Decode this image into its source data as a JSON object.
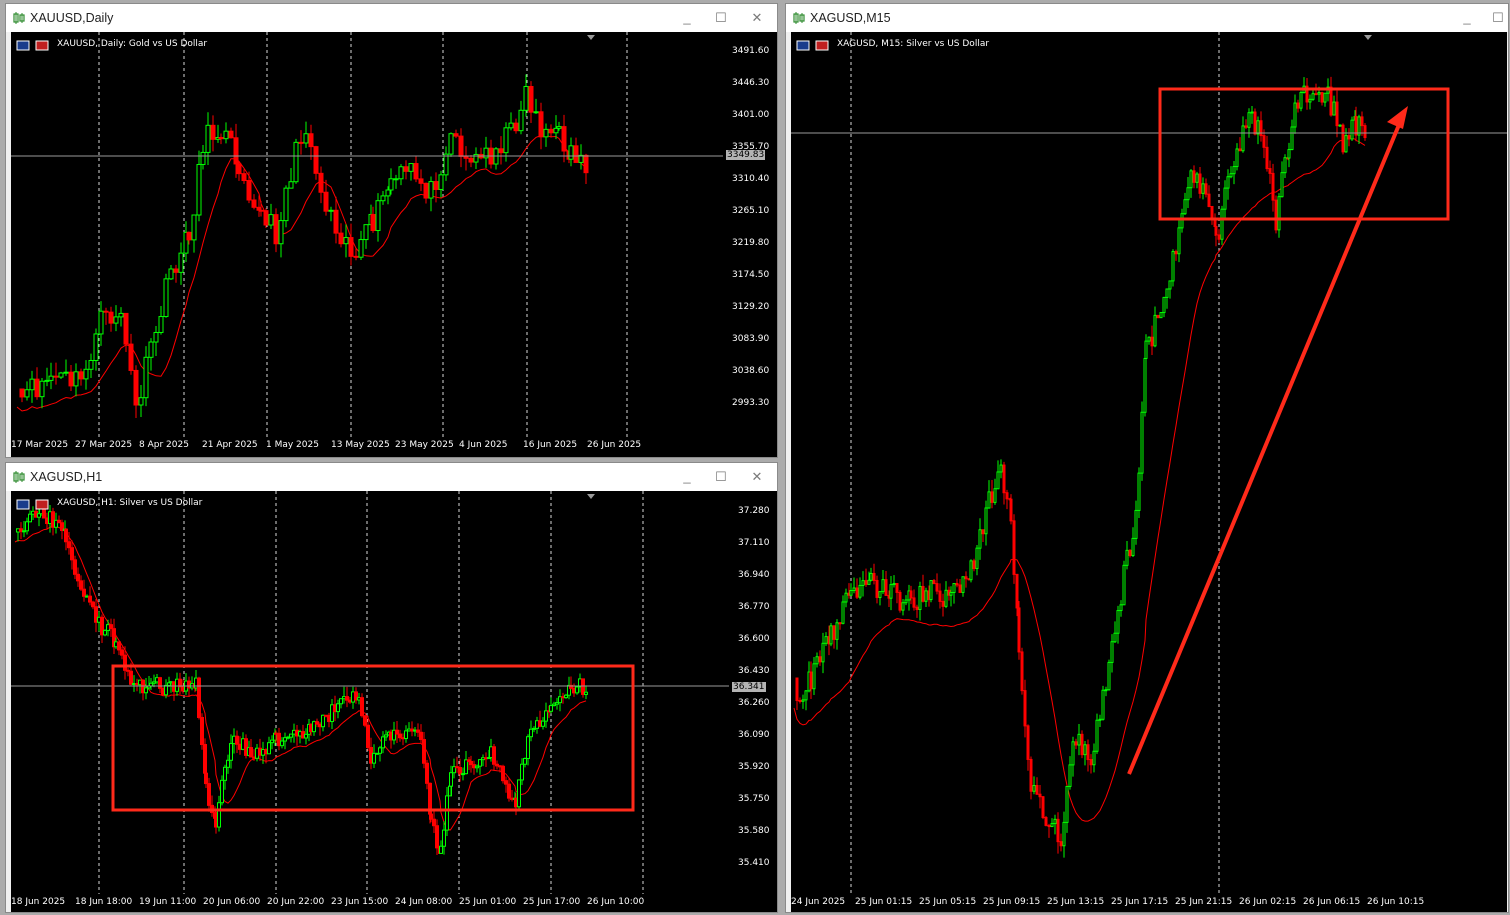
{
  "windows": {
    "gold_daily": {
      "title": "XAUUSD,Daily",
      "chart_title": "XAUUSD, Daily:  Gold vs US Dollar",
      "price_tag": "3349.83",
      "y_ticks": [
        "3491.60",
        "3446.30",
        "3401.00",
        "3355.70",
        "3310.40",
        "3265.10",
        "3219.80",
        "3174.50",
        "3129.20",
        "3083.90",
        "3038.60",
        "2993.30"
      ],
      "x_ticks": [
        "17 Mar 2025",
        "27 Mar 2025",
        "8 Apr 2025",
        "21 Apr 2025",
        "1 May 2025",
        "13 May 2025",
        "23 May 2025",
        "4 Jun 2025",
        "16 Jun 2025",
        "26 Jun 2025"
      ]
    },
    "silver_h1": {
      "title": "XAGUSD,H1",
      "chart_title": "XAGUSD, H1:  Silver vs US Dollar",
      "price_tag": "36.341",
      "y_ticks": [
        "37.280",
        "37.110",
        "36.940",
        "36.770",
        "36.600",
        "36.430",
        "36.260",
        "36.090",
        "35.920",
        "35.750",
        "35.580",
        "35.410"
      ],
      "x_ticks": [
        "18 Jun 2025",
        "18 Jun 18:00",
        "19 Jun 11:00",
        "20 Jun 06:00",
        "20 Jun 22:00",
        "23 Jun 15:00",
        "24 Jun 08:00",
        "25 Jun 01:00",
        "25 Jun 17:00",
        "26 Jun 10:00"
      ]
    },
    "silver_m15": {
      "title": "XAGUSD,M15",
      "chart_title": "XAGUSD, M15:  Silver vs US Dollar",
      "x_ticks": [
        "24 Jun 2025",
        "25 Jun 01:15",
        "25 Jun 05:15",
        "25 Jun 09:15",
        "25 Jun 13:15",
        "25 Jun 17:15",
        "25 Jun 21:15",
        "26 Jun 02:15",
        "26 Jun 06:15",
        "26 Jun 10:15"
      ]
    }
  },
  "colors": {
    "bull": "#00ff00",
    "bear": "#ff0000",
    "ma": "#ff0000",
    "annotation": "#ff2a1a",
    "grid": "#ffffff"
  },
  "icons": {
    "window": "candlestick-chart-icon",
    "minimize": "minimize-icon",
    "maximize": "maximize-icon",
    "close": "close-icon"
  }
}
